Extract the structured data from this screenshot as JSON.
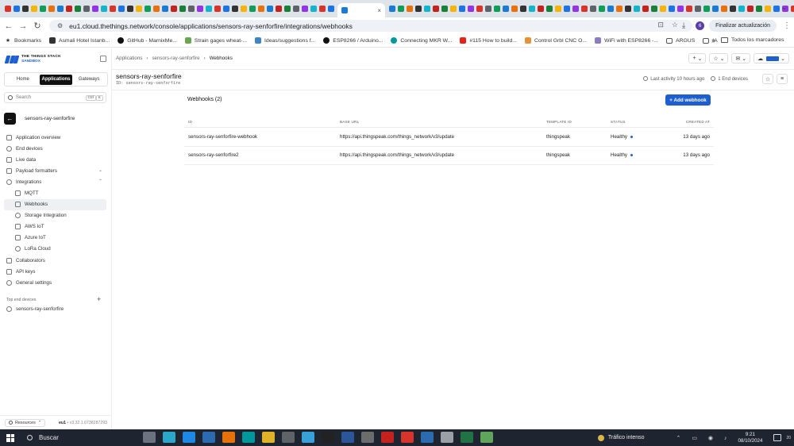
{
  "browser": {
    "active_tab_close": "×",
    "tab_colors": [
      "#d9342b",
      "#1a73e8",
      "#333333",
      "#f4b400",
      "#0f9d58",
      "#e8710a",
      "#1a7bd4",
      "#c5221f",
      "#188038",
      "#5f6368",
      "#9334e6",
      "#12b5cb",
      "#d9342b",
      "#1a73e8",
      "#333333",
      "#f4b400",
      "#0f9d58",
      "#e8710a",
      "#1a7bd4",
      "#c5221f",
      "#188038",
      "#5f6368",
      "#9334e6",
      "#12b5cb",
      "#d9342b",
      "#1a73e8",
      "#333333",
      "#f4b400",
      "#0f9d58",
      "#e8710a",
      "#1a7bd4",
      "#c5221f",
      "#188038",
      "#5f6368",
      "#9334e6",
      "#12b5cb",
      "#d9342b",
      "#1a73e8"
    ],
    "tab_colors_right": [
      "#1a7bd4",
      "#0f9d58",
      "#e8710a",
      "#333333",
      "#12b5cb",
      "#c5221f",
      "#188038",
      "#f4b400",
      "#1a73e8",
      "#9334e6",
      "#d9342b",
      "#5f6368",
      "#0f9d58",
      "#1a7bd4",
      "#e8710a",
      "#333333",
      "#12b5cb",
      "#c5221f",
      "#188038",
      "#f4b400",
      "#1a73e8",
      "#9334e6",
      "#d9342b",
      "#5f6368",
      "#0f9d58",
      "#1a7bd4",
      "#e8710a",
      "#333333",
      "#12b5cb",
      "#c5221f",
      "#188038",
      "#f4b400",
      "#1a73e8",
      "#9334e6",
      "#d9342b",
      "#5f6368",
      "#0f9d58",
      "#1a7bd4",
      "#e8710a",
      "#333333",
      "#12b5cb",
      "#c5221f",
      "#188038",
      "#f4b400",
      "#1a73e8",
      "#9334e6",
      "#d9342b",
      "#5f6368"
    ],
    "url": "eu1.cloud.thethings.network/console/applications/sensors-ray-senforfire/integrations/webhooks",
    "profile_initial": "6",
    "update_button": "Finalizar actualización",
    "bookmarks": [
      {
        "label": "Bookmarks",
        "icon": "star-icon",
        "glyph": "★",
        "color": "#ffffff"
      },
      {
        "label": "Asmali Hotel Istanb...",
        "icon": "hotel-icon",
        "glyph": "",
        "color": "#333333"
      },
      {
        "label": "GitHub - MarnixMe...",
        "icon": "github-icon",
        "glyph": "",
        "color": "#111111"
      },
      {
        "label": "Strain gages wheat-...",
        "icon": "gauge-icon",
        "glyph": "",
        "color": "#6aa84f"
      },
      {
        "label": "Ideas/suggestions f...",
        "icon": "chat-icon",
        "glyph": "",
        "color": "#3d85c6"
      },
      {
        "label": "ESP8266 / Arduino...",
        "icon": "github-icon",
        "glyph": "",
        "color": "#111111"
      },
      {
        "label": "Connecting MKR W...",
        "icon": "arduino-icon",
        "glyph": "",
        "color": "#00979d"
      },
      {
        "label": "#115 How to build...",
        "icon": "youtube-icon",
        "glyph": "",
        "color": "#e62117"
      },
      {
        "label": "Control Grbl CNC O...",
        "icon": "cnc-icon",
        "glyph": "",
        "color": "#e69138"
      },
      {
        "label": "WiFi with ESP8266 -...",
        "icon": "wifi-icon",
        "glyph": "",
        "color": "#8e7cc3"
      },
      {
        "label": "ARGUS",
        "icon": "folder-icon",
        "glyph": "",
        "color": "#ffffff"
      },
      {
        "label": "IA",
        "icon": "folder-icon",
        "glyph": "",
        "color": "#ffffff"
      }
    ],
    "bookmarks_all": "Todos los marcadores"
  },
  "sidebar": {
    "logo_line1": "THE THINGS STACK",
    "logo_line2": "SANDBOX",
    "segments": [
      {
        "label": "Home",
        "active": false
      },
      {
        "label": "Applications",
        "active": true
      },
      {
        "label": "Gateways",
        "active": false
      }
    ],
    "search_placeholder": "Search",
    "search_kbd": "Ctrl",
    "search_kbd2": "K",
    "entity_name": "sensors-ray-senforfire",
    "nav_items": [
      {
        "label": "Application overview",
        "sub": false,
        "active": false,
        "caret": ""
      },
      {
        "label": "End devices",
        "sub": false,
        "active": false,
        "caret": ""
      },
      {
        "label": "Live data",
        "sub": false,
        "active": false,
        "caret": ""
      },
      {
        "label": "Payload formatters",
        "sub": false,
        "active": false,
        "caret": "⌄"
      },
      {
        "label": "Integrations",
        "sub": false,
        "active": false,
        "caret": "⌃"
      },
      {
        "label": "MQTT",
        "sub": true,
        "active": false,
        "caret": ""
      },
      {
        "label": "Webhooks",
        "sub": true,
        "active": true,
        "caret": ""
      },
      {
        "label": "Storage Integration",
        "sub": true,
        "active": false,
        "caret": ""
      },
      {
        "label": "AWS IoT",
        "sub": true,
        "active": false,
        "caret": ""
      },
      {
        "label": "Azure IoT",
        "sub": true,
        "active": false,
        "caret": ""
      },
      {
        "label": "LoRa Cloud",
        "sub": true,
        "active": false,
        "caret": ""
      },
      {
        "label": "Collaborators",
        "sub": false,
        "active": false,
        "caret": ""
      },
      {
        "label": "API keys",
        "sub": false,
        "active": false,
        "caret": ""
      },
      {
        "label": "General settings",
        "sub": false,
        "active": false,
        "caret": ""
      }
    ],
    "top_end_label": "Top end devices",
    "top_end_item": "sensors-ray-senforfire",
    "resources": "Resources",
    "version_region": "eu1",
    "version": "v3.32.1.6738287293"
  },
  "main": {
    "breadcrumb": [
      "Applications",
      "sensors-ray-senforfire",
      "Webhooks"
    ],
    "app_title": "sensors-ray-senforfire",
    "app_id": "ID: sensors-ray-senforfire",
    "last_activity": "Last activity 10 hours ago",
    "end_devices": "1 End devices",
    "webhooks_title": "Webhooks (2)",
    "add_button": "+ Add webhook",
    "columns": [
      "ID",
      "BASE URL",
      "TEMPLATE ID",
      "STATUS",
      "CREATED AT"
    ],
    "rows": [
      {
        "id": "sensors-ray-senforfire-webhook",
        "url": "https://api.thingspeak.com/things_network/v3/update",
        "template": "thingspeak",
        "status": "Healthy",
        "created": "13 days ago"
      },
      {
        "id": "sensors-ray-senforfire2",
        "url": "https://api.thingspeak.com/things_network/v3/update",
        "template": "thingspeak",
        "status": "Healthy",
        "created": "13 days ago"
      }
    ]
  },
  "taskbar": {
    "search": "Buscar",
    "app_colors": [
      "#6b7280",
      "#2aa7c9",
      "#1e88e5",
      "#2b6cb0",
      "#e8710a",
      "#00979d",
      "#e0b228",
      "#5f6368",
      "#3aa0d8",
      "#222222",
      "#2b579a",
      "#6c6c6c",
      "#c5221f",
      "#d9342b",
      "#2b6cb0",
      "#9aa0a6",
      "#217346",
      "#5fa55a"
    ],
    "traffic": "Tráfico intenso",
    "time": "9:21",
    "date": "08/10/2024",
    "notification_count": "20"
  }
}
